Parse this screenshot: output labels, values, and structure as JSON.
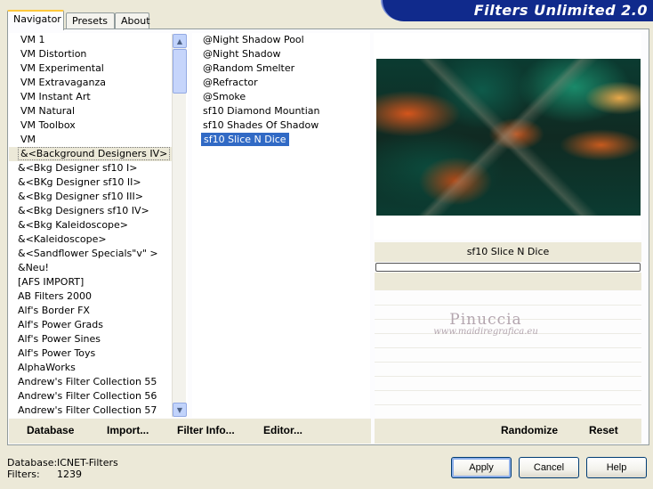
{
  "app": {
    "title": "Filters Unlimited 2.0"
  },
  "tabs": [
    {
      "label": "Navigator",
      "active": true
    },
    {
      "label": "Presets",
      "active": false
    },
    {
      "label": "About",
      "active": false
    }
  ],
  "categories": {
    "selected": "&<Background Designers IV>",
    "items": [
      "VM 1",
      "VM Distortion",
      "VM Experimental",
      "VM Extravaganza",
      "VM Instant Art",
      "VM Natural",
      "VM Toolbox",
      "VM",
      "&<Background Designers IV>",
      "&<Bkg Designer sf10 I>",
      "&<BKg Designer sf10 II>",
      "&<Bkg Designer sf10 III>",
      "&<Bkg Designers sf10 IV>",
      "&<Bkg Kaleidoscope>",
      "&<Kaleidoscope>",
      "&<Sandflower Specials\"v\" >",
      "&Neu!",
      "[AFS IMPORT]",
      "AB Filters 2000",
      "Alf's Border FX",
      "Alf's Power Grads",
      "Alf's Power Sines",
      "Alf's Power Toys",
      "AlphaWorks",
      "Andrew's Filter Collection 55",
      "Andrew's Filter Collection 56",
      "Andrew's Filter Collection 57"
    ]
  },
  "filters": {
    "selected": "sf10 Slice N Dice",
    "items": [
      "@Night Shadow Pool",
      "@Night Shadow",
      "@Random Smelter",
      "@Refractor",
      "@Smoke",
      "sf10 Diamond Mountian",
      "sf10 Shades Of Shadow",
      "sf10 Slice N Dice"
    ]
  },
  "preview": {
    "filter_name": "sf10 Slice N Dice",
    "progress": 0.0,
    "watermark_name": "Pinuccia",
    "watermark_url": "www.maidiregrafica.eu"
  },
  "toolbar": {
    "database": "Database",
    "import": "Import...",
    "filter_info": "Filter Info...",
    "editor": "Editor...",
    "randomize": "Randomize",
    "reset": "Reset"
  },
  "footer": {
    "database_label": "Database:",
    "database_value": "ICNET-Filters",
    "filters_label": "Filters:",
    "filters_value": "1239",
    "apply": "Apply",
    "cancel": "Cancel",
    "help": "Help"
  },
  "colors": {
    "banner": "#102a8c",
    "selection": "#316ac5",
    "dialog_bg": "#ece9d8"
  }
}
